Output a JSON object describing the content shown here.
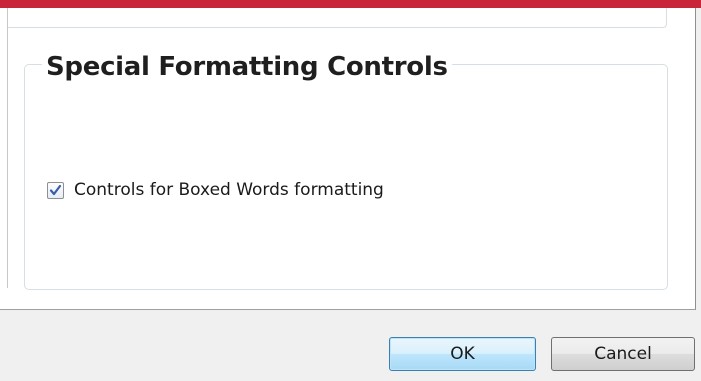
{
  "group": {
    "title": "Special Formatting Controls"
  },
  "options": {
    "boxed_words": {
      "label": "Controls for Boxed Words formatting",
      "checked": true
    }
  },
  "buttons": {
    "ok_label": "OK",
    "cancel_label": "Cancel"
  },
  "colors": {
    "title_bar_accent": "#c8253a",
    "checkmark": "#3a5ea8",
    "ok_button_border": "#3c7fb1"
  }
}
